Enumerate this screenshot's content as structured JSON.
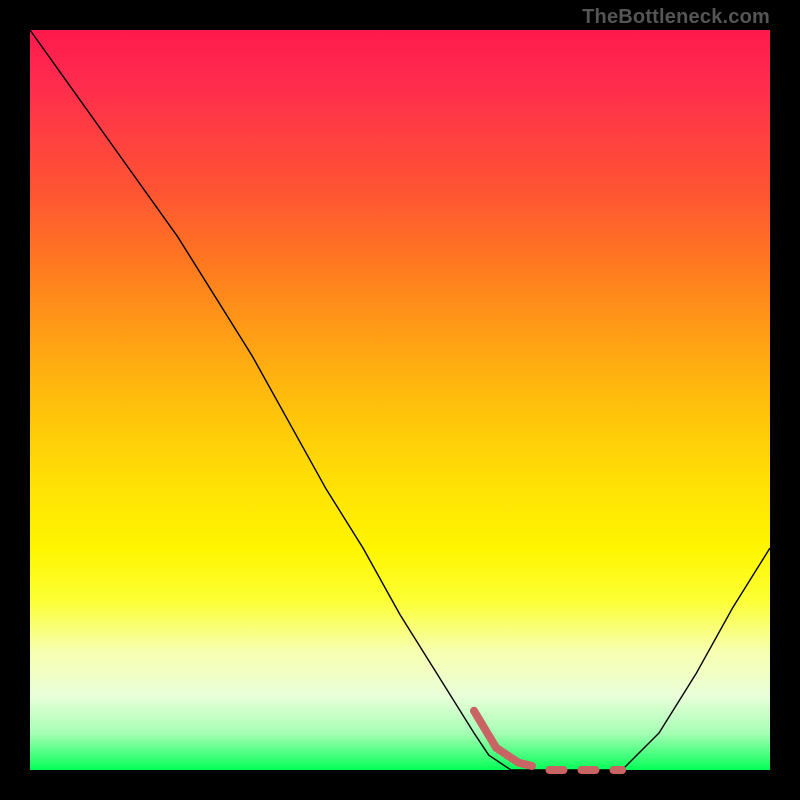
{
  "watermark": "TheBottleneck.com",
  "chart_data": {
    "type": "line",
    "title": "",
    "xlabel": "",
    "ylabel": "",
    "xlim": [
      0,
      100
    ],
    "ylim": [
      0,
      100
    ],
    "grid": false,
    "legend": false,
    "series": [
      {
        "name": "bottleneck-curve",
        "color": "#000000",
        "stroke_width": 1.4,
        "x": [
          0,
          5,
          10,
          15,
          20,
          25,
          30,
          35,
          40,
          45,
          50,
          55,
          60,
          62,
          65,
          70,
          75,
          80,
          85,
          90,
          95,
          100
        ],
        "values": [
          100,
          93,
          86,
          79,
          72,
          64,
          56,
          47,
          38,
          30,
          21,
          13,
          5,
          2,
          0,
          0,
          0,
          0,
          5,
          13,
          22,
          30
        ]
      },
      {
        "name": "optimal-range",
        "color": "#c86464",
        "stroke_width": 8,
        "style": "dotted-then-solid",
        "x": [
          60,
          63,
          66,
          70,
          75,
          80
        ],
        "values": [
          8,
          3,
          1,
          0,
          0,
          0
        ]
      }
    ],
    "annotations": []
  },
  "colors": {
    "gradient_top": "#ff1a4d",
    "gradient_mid": "#ffe305",
    "gradient_bottom": "#00ff55",
    "curve": "#000000",
    "marker": "#c86464"
  }
}
